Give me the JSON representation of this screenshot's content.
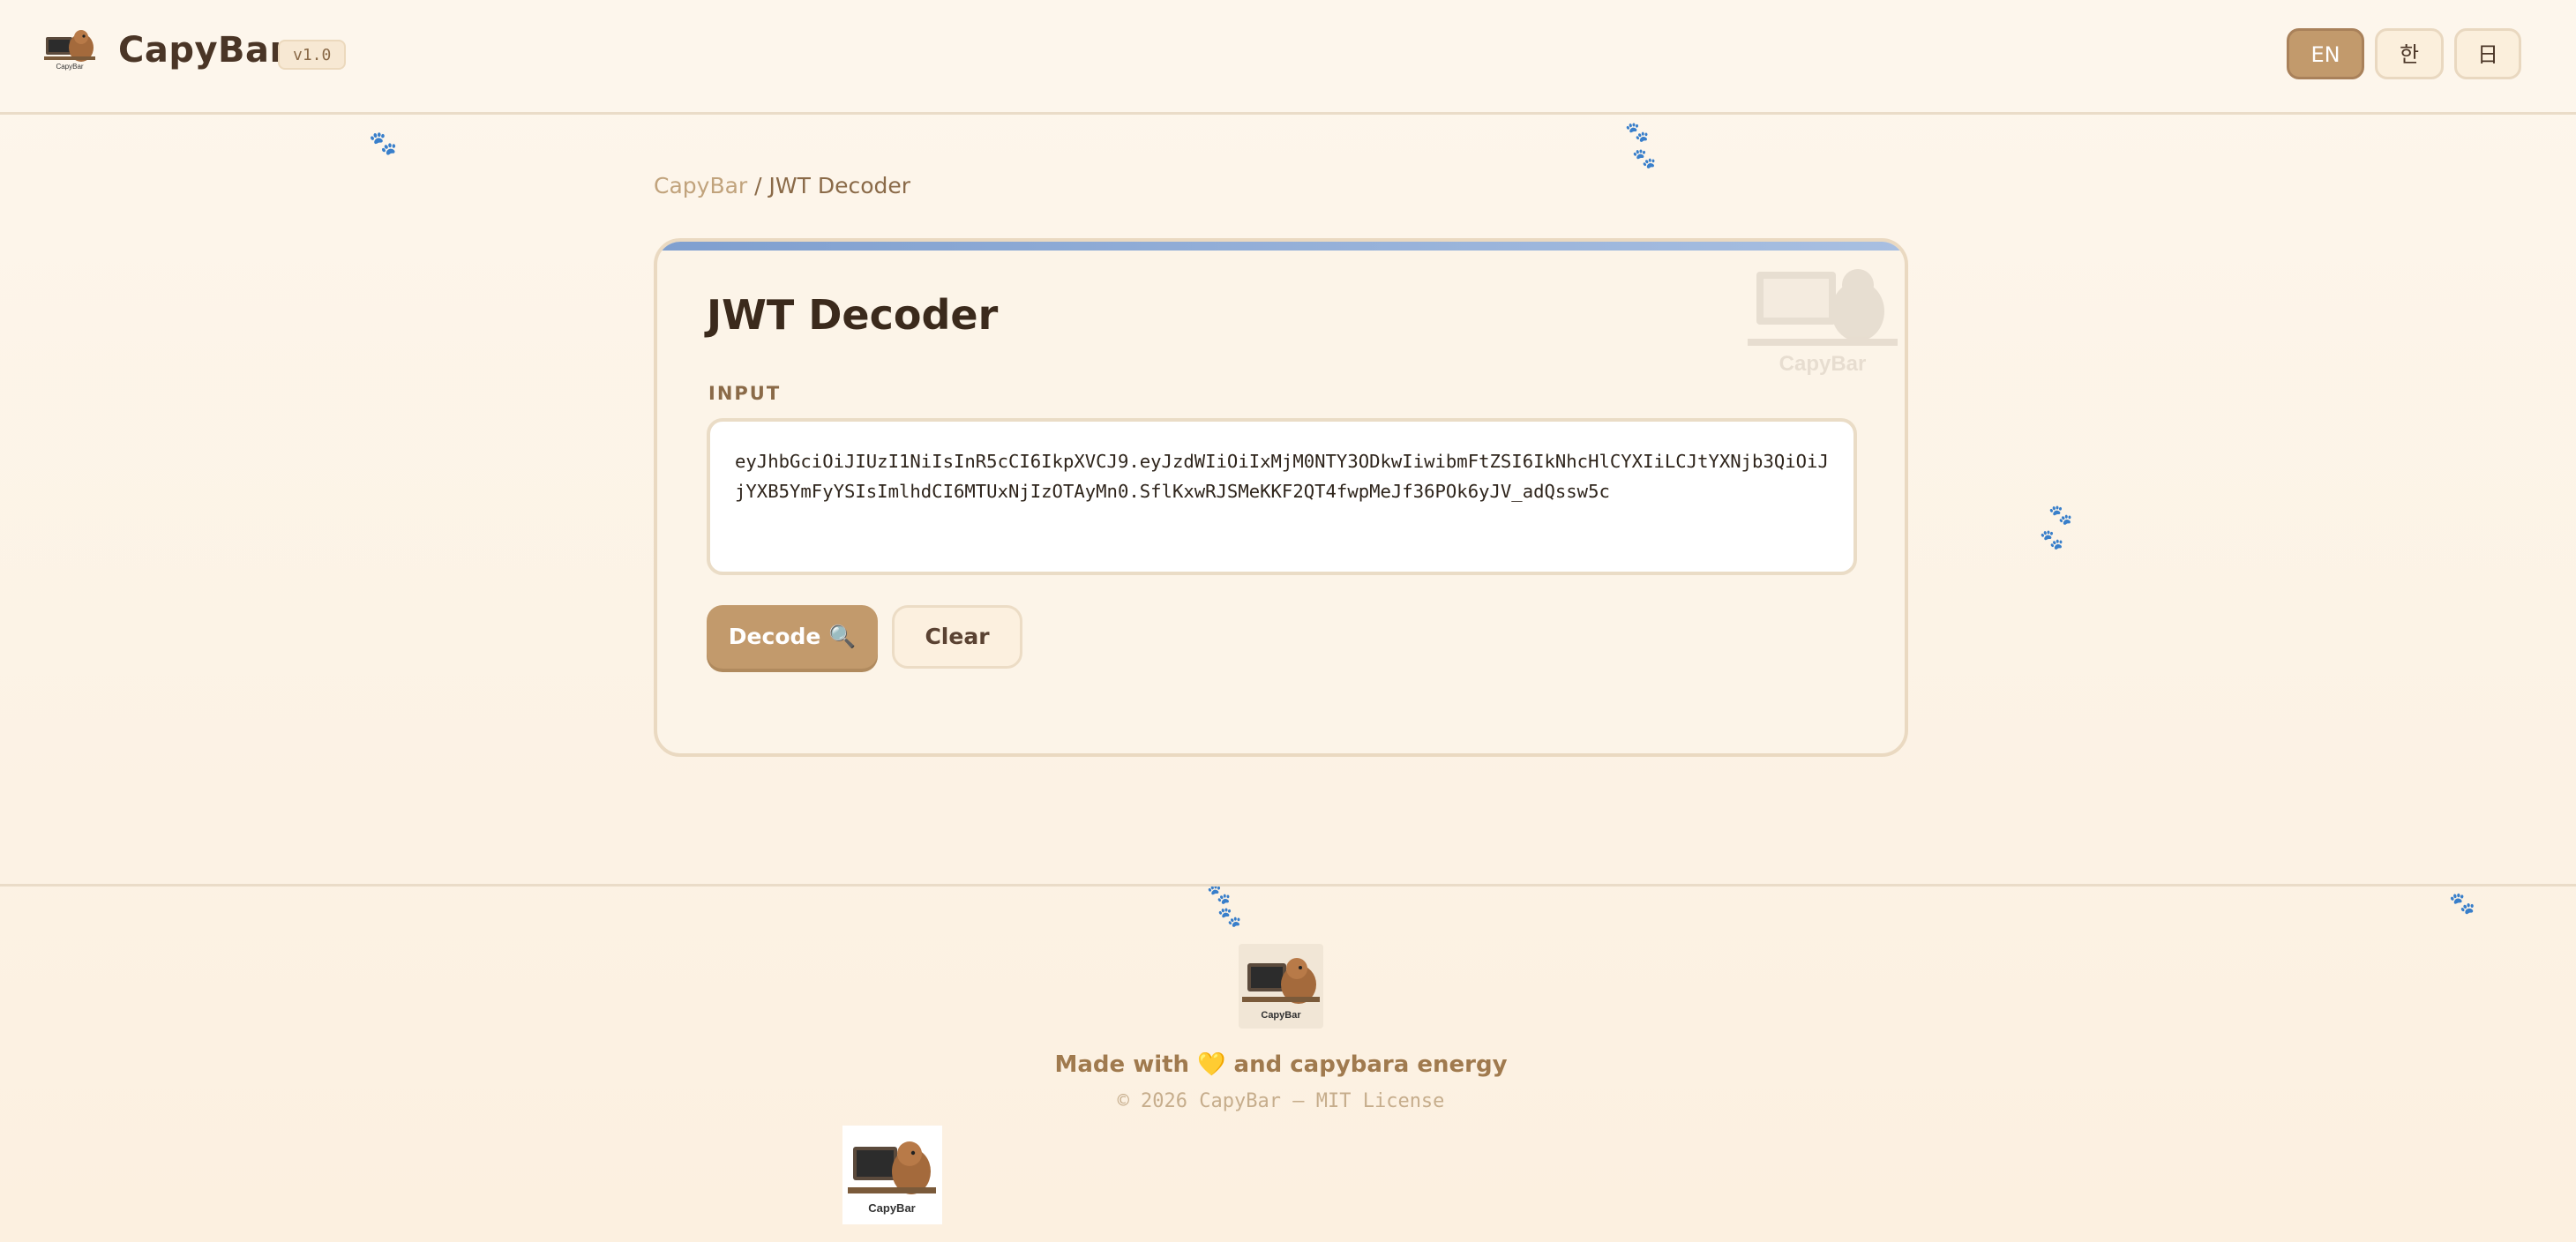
{
  "header": {
    "brand": "CapyBar",
    "version": "v1.0",
    "logo_icon": "capybar-logo-icon",
    "languages": [
      {
        "label": "EN",
        "active": true
      },
      {
        "label": "한",
        "active": false
      },
      {
        "label": "日",
        "active": false
      }
    ]
  },
  "breadcrumb": {
    "root": "CapyBar",
    "separator": " / ",
    "current": "JWT Decoder"
  },
  "tool": {
    "title": "JWT Decoder",
    "input_label": "INPUT",
    "token_value": "eyJhbGciOiJIUzI1NiIsInR5cCI6IkpXVCJ9.eyJzdWIiOiIxMjM0NTY3ODkwIiwibmFtZSI6IkNhcHlCYXIiLCJtYXNjb3QiOiJjYXB5YmFyYSIsImlhdCI6MTUxNjIzOTAyMn0.SflKxwRJSMeKKF2QT4fwpMeJf36POk6yJV_adQssw5c",
    "decode_label": "Decode 🔍",
    "clear_label": "Clear"
  },
  "footer": {
    "made_with": "Made with 💛 and capybara energy",
    "copyright": "© 2026 CapyBar — MIT License",
    "logo_caption": "CapyBar"
  },
  "colors": {
    "accent": "#c29a6c",
    "card_top_bar": "#7f9fcf",
    "background": "#fdf6ec",
    "text": "#3d2c1e"
  }
}
